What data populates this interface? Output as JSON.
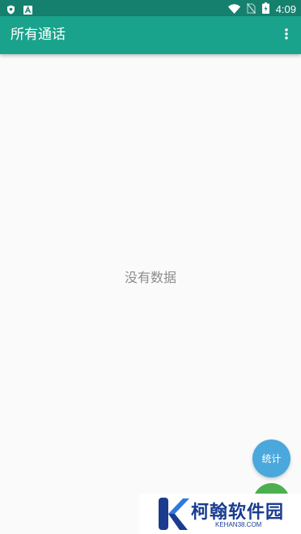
{
  "status_bar": {
    "time": "4:09",
    "icons": [
      "shield-icon",
      "a-icon",
      "wifi-icon",
      "no-sim-icon",
      "battery-icon"
    ]
  },
  "app_bar": {
    "title": "所有通话",
    "menu_icon": "more-vert-icon"
  },
  "content": {
    "empty_text": "没有数据"
  },
  "fabs": {
    "stats_label": "统计"
  },
  "watermark": {
    "name": "柯翰软件园",
    "site": "KEHAN38.COM"
  },
  "colors": {
    "status_bar": "#16806e",
    "app_bar": "#1aa38c",
    "background": "#fafafa",
    "fab_stats": "#4aa8dc",
    "fab_green": "#4caf50"
  }
}
